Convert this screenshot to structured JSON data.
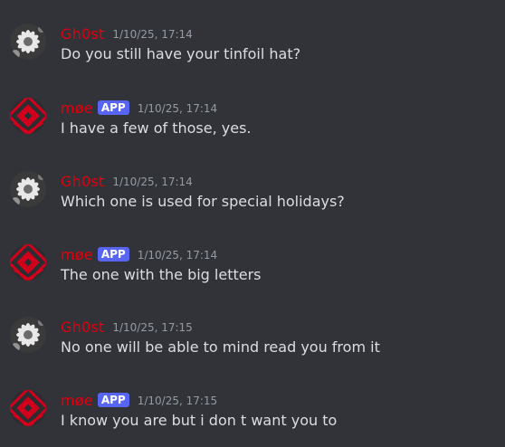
{
  "messages": [
    {
      "author": "Gh0st",
      "avatar": "flower-avatar-icon",
      "app_badge": "",
      "timestamp": "1/10/25, 17:14",
      "text": "Do you still have your tinfoil hat?"
    },
    {
      "author": "møe",
      "avatar": "red-diamond-logo-avatar-icon",
      "app_badge": "APP",
      "timestamp": "1/10/25, 17:14",
      "text": "I have a few of those, yes."
    },
    {
      "author": "Gh0st",
      "avatar": "flower-avatar-icon",
      "app_badge": "",
      "timestamp": "1/10/25, 17:14",
      "text": "Which one is used for special holidays?"
    },
    {
      "author": "møe",
      "avatar": "red-diamond-logo-avatar-icon",
      "app_badge": "APP",
      "timestamp": "1/10/25, 17:14",
      "text": "The one with the big letters"
    },
    {
      "author": "Gh0st",
      "avatar": "flower-avatar-icon",
      "app_badge": "",
      "timestamp": "1/10/25, 17:15",
      "text": "No one will be able to mind read you from it"
    },
    {
      "author": "møe",
      "avatar": "red-diamond-logo-avatar-icon",
      "app_badge": "APP",
      "timestamp": "1/10/25, 17:15",
      "text": "I know you are but i don t want you to"
    }
  ],
  "colors": {
    "background": "#313338",
    "username": "#e0000f",
    "app_badge": "#5865f2",
    "timestamp": "#949ba4",
    "message_text": "#dbdee1"
  }
}
